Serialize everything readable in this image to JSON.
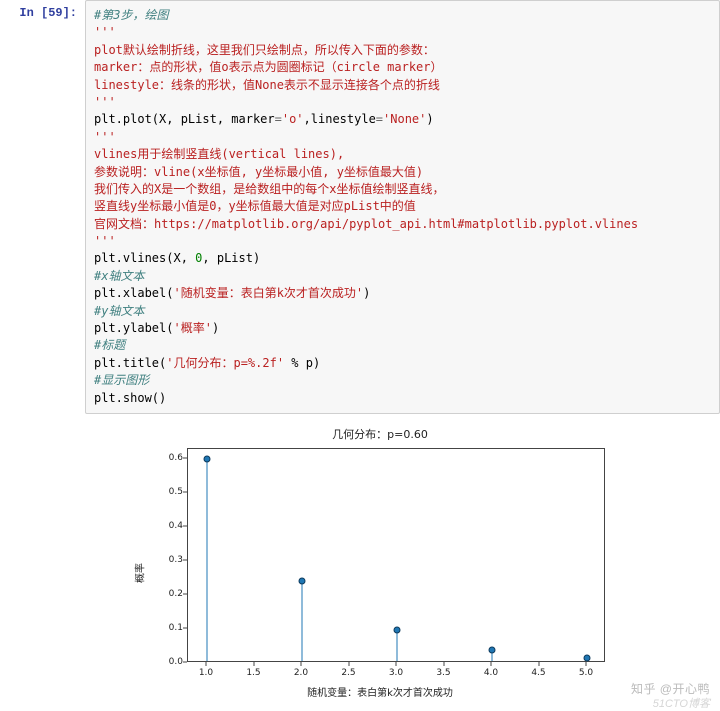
{
  "prompt": "In [59]:",
  "code": [
    {
      "kind": "cit",
      "text": "#第3步，绘图"
    },
    {
      "kind": "str",
      "text": "'''"
    },
    {
      "kind": "str",
      "text": "plot默认绘制折线，这里我们只绘制点，所以传入下面的参数："
    },
    {
      "kind": "str",
      "text": "marker：点的形状，值o表示点为圆圈标记（circle marker）"
    },
    {
      "kind": "str",
      "text": "linestyle：线条的形状，值None表示不显示连接各个点的折线"
    },
    {
      "kind": "str",
      "text": "'''"
    },
    {
      "kind": "plot",
      "text": ""
    },
    {
      "kind": "str",
      "text": "'''"
    },
    {
      "kind": "str",
      "text": "vlines用于绘制竖直线(vertical lines),"
    },
    {
      "kind": "str",
      "text": "参数说明：vline(x坐标值, y坐标最小值, y坐标值最大值)"
    },
    {
      "kind": "str",
      "text": "我们传入的X是一个数组，是给数组中的每个x坐标值绘制竖直线，"
    },
    {
      "kind": "str",
      "text": "竖直线y坐标最小值是0，y坐标值最大值是对应pList中的值"
    },
    {
      "kind": "str",
      "text": "官网文档：https://matplotlib.org/api/pyplot_api.html#matplotlib.pyplot.vlines"
    },
    {
      "kind": "str",
      "text": "'''"
    },
    {
      "kind": "vlines",
      "text": ""
    },
    {
      "kind": "cit",
      "text": "#x轴文本"
    },
    {
      "kind": "xlabel",
      "text": ""
    },
    {
      "kind": "cit",
      "text": "#y轴文本"
    },
    {
      "kind": "ylabel",
      "text": ""
    },
    {
      "kind": "cit",
      "text": "#标题"
    },
    {
      "kind": "title",
      "text": ""
    },
    {
      "kind": "cit",
      "text": "#显示图形"
    },
    {
      "kind": "show",
      "text": ""
    }
  ],
  "code_parts": {
    "plot_pre": "plt.plot(X, pList, marker",
    "plot_eq": "=",
    "plot_s1": "'o'",
    "plot_mid": ",linestyle",
    "plot_s2": "'None'",
    "plot_end": ")",
    "vlines_pre": "plt.vlines(X, ",
    "vlines_zero": "0",
    "vlines_end": ", pList)",
    "xlabel_pre": "plt.xlabel(",
    "xlabel_s": "'随机变量：表白第k次才首次成功'",
    "xlabel_end": ")",
    "ylabel_pre": "plt.ylabel(",
    "ylabel_s": "'概率'",
    "ylabel_end": ")",
    "title_pre": "plt.title(",
    "title_s": "'几何分布：p=%.2f'",
    "title_mid": " % p)",
    "show": "plt.show()"
  },
  "chart_data": {
    "type": "bar",
    "title": "几何分布：p=0.60",
    "xlabel": "随机变量：表白第k次才首次成功",
    "ylabel": "概率",
    "x": [
      1.0,
      2.0,
      3.0,
      4.0,
      5.0
    ],
    "values": [
      0.6,
      0.24,
      0.096,
      0.0384,
      0.01536
    ],
    "xticks": [
      1.0,
      1.5,
      2.0,
      2.5,
      3.0,
      3.5,
      4.0,
      4.5,
      5.0
    ],
    "yticks": [
      0.0,
      0.1,
      0.2,
      0.3,
      0.4,
      0.5,
      0.6
    ],
    "xlim": [
      0.8,
      5.2
    ],
    "ylim": [
      0.0,
      0.63
    ]
  },
  "watermark": "知乎 @开心鸭",
  "watermark2": "51CTO博客"
}
